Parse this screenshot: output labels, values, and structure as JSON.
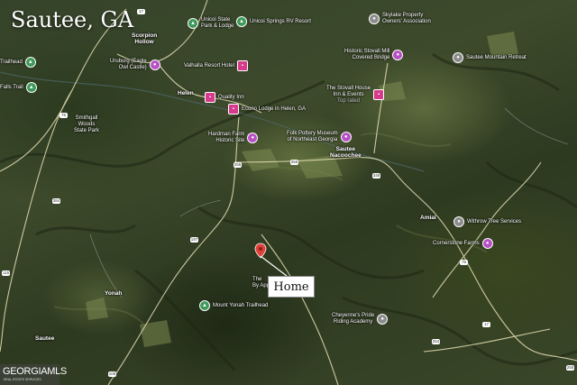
{
  "map_title": "Sautee, GA",
  "marker_label": "Home",
  "watermark": {
    "main": "GEORGIAMLS",
    "sub": "REAL ESTATE SERVICES"
  },
  "marker_color": "#e0403a",
  "pois": [
    {
      "name": "Unicoi State Park & Lodge",
      "line1": "Unicoi State",
      "line2": "Park & Lodge",
      "icon": "park-icon",
      "color": "#3f9a5a"
    },
    {
      "name": "Unicoi Springs RV Resort",
      "line1": "Unicoi Springs RV Resort",
      "icon": "camping-icon",
      "color": "#3f9a5a"
    },
    {
      "name": "Skylake Property Owners' Association",
      "line1": "Skylake Property",
      "line2": "Owners' Association",
      "icon": "place-icon",
      "color": "#8b8b8b"
    },
    {
      "name": "Uruburg Eagle Owl Castle",
      "line1": "Uruburg (Eagle",
      "line2": "Owl Castle)",
      "icon": "landmark-icon",
      "color": "#b84fc6"
    },
    {
      "name": "Valhalla Resort Hotel",
      "line1": "Valhalla Resort Hotel",
      "icon": "hotel-icon",
      "color": "#d63a8a"
    },
    {
      "name": "Historic Stovall Mill Covered Bridge",
      "line1": "Historic Stovall Mill",
      "line2": "Covered Bridge",
      "icon": "landmark-icon",
      "color": "#b84fc6"
    },
    {
      "name": "Sautee Mountain Retreat",
      "line1": "Sautee Mountain Retreat",
      "icon": "place-icon",
      "color": "#8b8b8b"
    },
    {
      "name": "Quality Inn",
      "line1": "Quality Inn",
      "icon": "hotel-icon",
      "color": "#d63a8a"
    },
    {
      "name": "Econo Lodge in Helen, GA",
      "line1": "Econo Lodge in Helen, GA",
      "icon": "hotel-icon",
      "color": "#d63a8a"
    },
    {
      "name": "The Stovall House Inn & Events",
      "line1": "The Stovall House",
      "line2": "Inn & Events",
      "line3": "Top rated",
      "icon": "hotel-icon",
      "color": "#d63a8a"
    },
    {
      "name": "Smithgall Woods State Park",
      "line1": "Smithgall",
      "line2": "Woods",
      "line3": "State Park",
      "icon": "park-icon",
      "color": "#3f9a5a"
    },
    {
      "name": "Hardman Farm Historic Site",
      "line1": "Hardman Farm",
      "line2": "Historic Site",
      "icon": "landmark-icon",
      "color": "#b84fc6"
    },
    {
      "name": "Folk Pottery Museum of Northeast Georgia",
      "line1": "Folk Pottery Museum",
      "line2": "of Northeast Georgia",
      "icon": "museum-icon",
      "color": "#b84fc6"
    },
    {
      "name": "Withrow Tree Services",
      "line1": "Withrow Tree Services",
      "icon": "place-icon",
      "color": "#8b8b8b"
    },
    {
      "name": "Cornerstone Farms",
      "line1": "Cornerstone Farms",
      "icon": "farm-icon",
      "color": "#b84fc6"
    },
    {
      "name": "Mount Yonah Trailhead",
      "line1": "Mount Yonah Trailhead",
      "icon": "trail-icon",
      "color": "#3f9a5a"
    },
    {
      "name": "Cheyenne's Pride Riding Academy",
      "line1": "Cheyenne's Pride",
      "line2": "Riding Academy",
      "icon": "place-icon",
      "color": "#8b8b8b"
    },
    {
      "name": "Trailhead",
      "line1": "Trailhead",
      "icon": "trail-icon",
      "color": "#3f9a5a"
    },
    {
      "name": "Falls Trail",
      "line1": "Falls Trail",
      "icon": "trail-icon",
      "color": "#3f9a5a"
    }
  ],
  "towns": {
    "scorpion_hollow": {
      "line1": "Scorpion",
      "line2": "Hollow"
    },
    "helen": "Helen",
    "sautee_nacoochee": {
      "line1": "Sautee",
      "line2": "Nacoochee"
    },
    "amial": "Amial",
    "yonah": "Yonah",
    "sautee": "Sautee"
  },
  "partial_label": {
    "line1": "The",
    "line2": "By App"
  },
  "road_shields": [
    "17",
    "75",
    "255",
    "356",
    "348",
    "384",
    "197",
    "75",
    "115",
    "17",
    "254",
    "105",
    "255"
  ]
}
